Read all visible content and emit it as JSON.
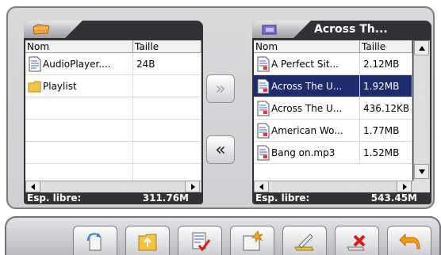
{
  "left_panel": {
    "columns": [
      "Nom",
      "Taille"
    ],
    "rows": [
      {
        "name": "AudioPlayer....",
        "size": "24B",
        "icon": "file-icon"
      },
      {
        "name": "Playlist",
        "size": "",
        "icon": "folder-icon"
      },
      {
        "name": "",
        "size": ""
      },
      {
        "name": "",
        "size": ""
      },
      {
        "name": "",
        "size": ""
      },
      {
        "name": "",
        "size": ""
      }
    ],
    "free_label": "Esp. libre:",
    "free_value": "311.76M"
  },
  "right_panel": {
    "title": "Across Th...",
    "columns": [
      "Nom",
      "Taille"
    ],
    "rows": [
      {
        "name": "A Perfect Sit...",
        "size": "2.12MB",
        "selected": false
      },
      {
        "name": "Across The U...",
        "size": "1.92MB",
        "selected": true
      },
      {
        "name": "Across The U...",
        "size": "436.12KB",
        "selected": false
      },
      {
        "name": "American Wo...",
        "size": "1.77MB",
        "selected": false
      },
      {
        "name": "Bang on.mp3",
        "size": "1.52MB",
        "selected": false
      }
    ],
    "free_label": "Esp. libre:",
    "free_value": "543.45M"
  },
  "copy_buttons": {
    "copy_right_label": "»",
    "copy_left_label": "«"
  },
  "toolbar": {
    "buttons": [
      "refresh-icon",
      "folder-up-icon",
      "select-check-icon",
      "new-folder-icon",
      "rename-icon",
      "delete-icon",
      "back-icon"
    ]
  }
}
